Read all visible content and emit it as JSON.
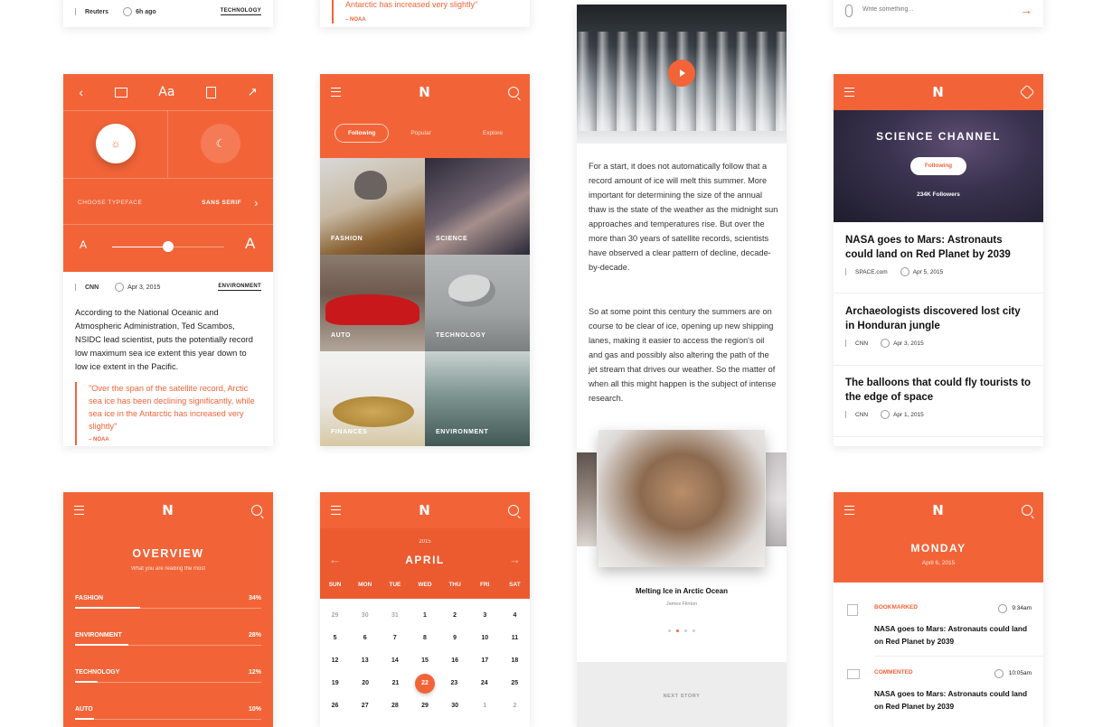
{
  "row0": {
    "card1": {
      "source": "Reuters",
      "time": "6h ago",
      "tag": "TECHNOLOGY"
    },
    "card2": {
      "quote_tail": "Antarctic has increased very slightly\"",
      "quote_source": "– NOAA"
    },
    "card4": {
      "placeholder": "Write something..."
    }
  },
  "settings": {
    "typeface_label": "CHOOSE TYPEFACE",
    "typeface_value": "SANS SERIF",
    "aa_label": "Aa",
    "font_small": "A",
    "font_large": "A",
    "font_size_slider": 0.52,
    "meta": {
      "source": "CNN",
      "date": "Apr 3, 2015",
      "tag": "ENVIRONMENT"
    },
    "body": "According to the National Oceanic and Atmospheric Administration, Ted Scambos, NSIDC lead scientist, puts the potentially record low maximum sea ice extent this year down to low ice extent in the Pacific.",
    "quote": "\"Over the span of the satellite record, Arctic sea ice has been declining significantly, while sea ice in the Antarctic has increased very slightly\"",
    "quote_source": "– NOAA"
  },
  "categories": {
    "logo": "N",
    "tabs": [
      "Following",
      "Popular",
      "Explore"
    ],
    "active_tab": "Following",
    "tiles": [
      "FASHION",
      "SCIENCE",
      "AUTO",
      "TECHNOLOGY",
      "FINANCES",
      "ENVIRONMENT"
    ]
  },
  "article": {
    "para1": "For a start, it does not automatically follow that a record amount of ice will melt this summer. More important for determining the size of the annual thaw is the state of the weather as the midnight sun approaches and temperatures rise. But over the more than 30 years of satellite records, scientists have observed a clear pattern of decline, decade-by-decade.",
    "para2": "So at some point this century the summers are on course to be clear of ice, opening up new shipping lanes, making it easier to access the region's oil and gas and possibly also altering the path of the jet stream that drives our weather. So the matter of when all this might happen is the subject of intense research.",
    "gallery_caption": "Melting Ice in Arctic Ocean",
    "gallery_author": "James Flinton",
    "next_story": "NEXT STORY"
  },
  "channel": {
    "logo": "N",
    "title": "SCIENCE CHANNEL",
    "follow_button": "Following",
    "followers": "234K Followers",
    "items": [
      {
        "title": "NASA goes to Mars: Astronauts could land on Red Planet by 2039",
        "source": "SPACE.com",
        "date": "Apr 5, 2015"
      },
      {
        "title": "Archaeologists discovered lost city in Honduran jungle",
        "source": "CNN",
        "date": "Apr 3, 2015"
      },
      {
        "title": "The balloons that could fly tourists to the edge of space",
        "source": "CNN",
        "date": "Apr 1, 2015"
      }
    ]
  },
  "overview": {
    "logo": "N",
    "title": "OVERVIEW",
    "subtitle": "What you are reading the most",
    "rows": [
      {
        "label": "FASHION",
        "value": "34%",
        "pct": 34
      },
      {
        "label": "ENVIRONMENT",
        "value": "28%",
        "pct": 28
      },
      {
        "label": "TECHNOLOGY",
        "value": "12%",
        "pct": 12
      },
      {
        "label": "AUTO",
        "value": "10%",
        "pct": 10
      }
    ]
  },
  "calendar": {
    "logo": "N",
    "year": "2015",
    "month": "APRIL",
    "weekdays": [
      "SUN",
      "MON",
      "TUE",
      "WED",
      "THU",
      "FRI",
      "SAT"
    ],
    "weeks": [
      [
        "29",
        "30",
        "31",
        "1",
        "2",
        "3",
        "4"
      ],
      [
        "5",
        "6",
        "7",
        "8",
        "9",
        "10",
        "11"
      ],
      [
        "12",
        "13",
        "14",
        "15",
        "16",
        "17",
        "18"
      ],
      [
        "19",
        "20",
        "21",
        "22",
        "23",
        "24",
        "25"
      ],
      [
        "26",
        "27",
        "28",
        "29",
        "30",
        "1",
        "2"
      ]
    ],
    "selected": "22"
  },
  "activity": {
    "logo": "N",
    "day": "MONDAY",
    "date": "April 6, 2015",
    "items": [
      {
        "type": "BOOKMARKED",
        "time": "9:34am",
        "title": "NASA goes to Mars: Astronauts could land on Red Planet by 2039"
      },
      {
        "type": "COMMENTED",
        "time": "10:05am",
        "title": "NASA goes to Mars: Astronauts could land on Red Planet by 2039"
      }
    ]
  },
  "colors": {
    "accent": "#f26438",
    "accent_dark": "#e8552b"
  }
}
